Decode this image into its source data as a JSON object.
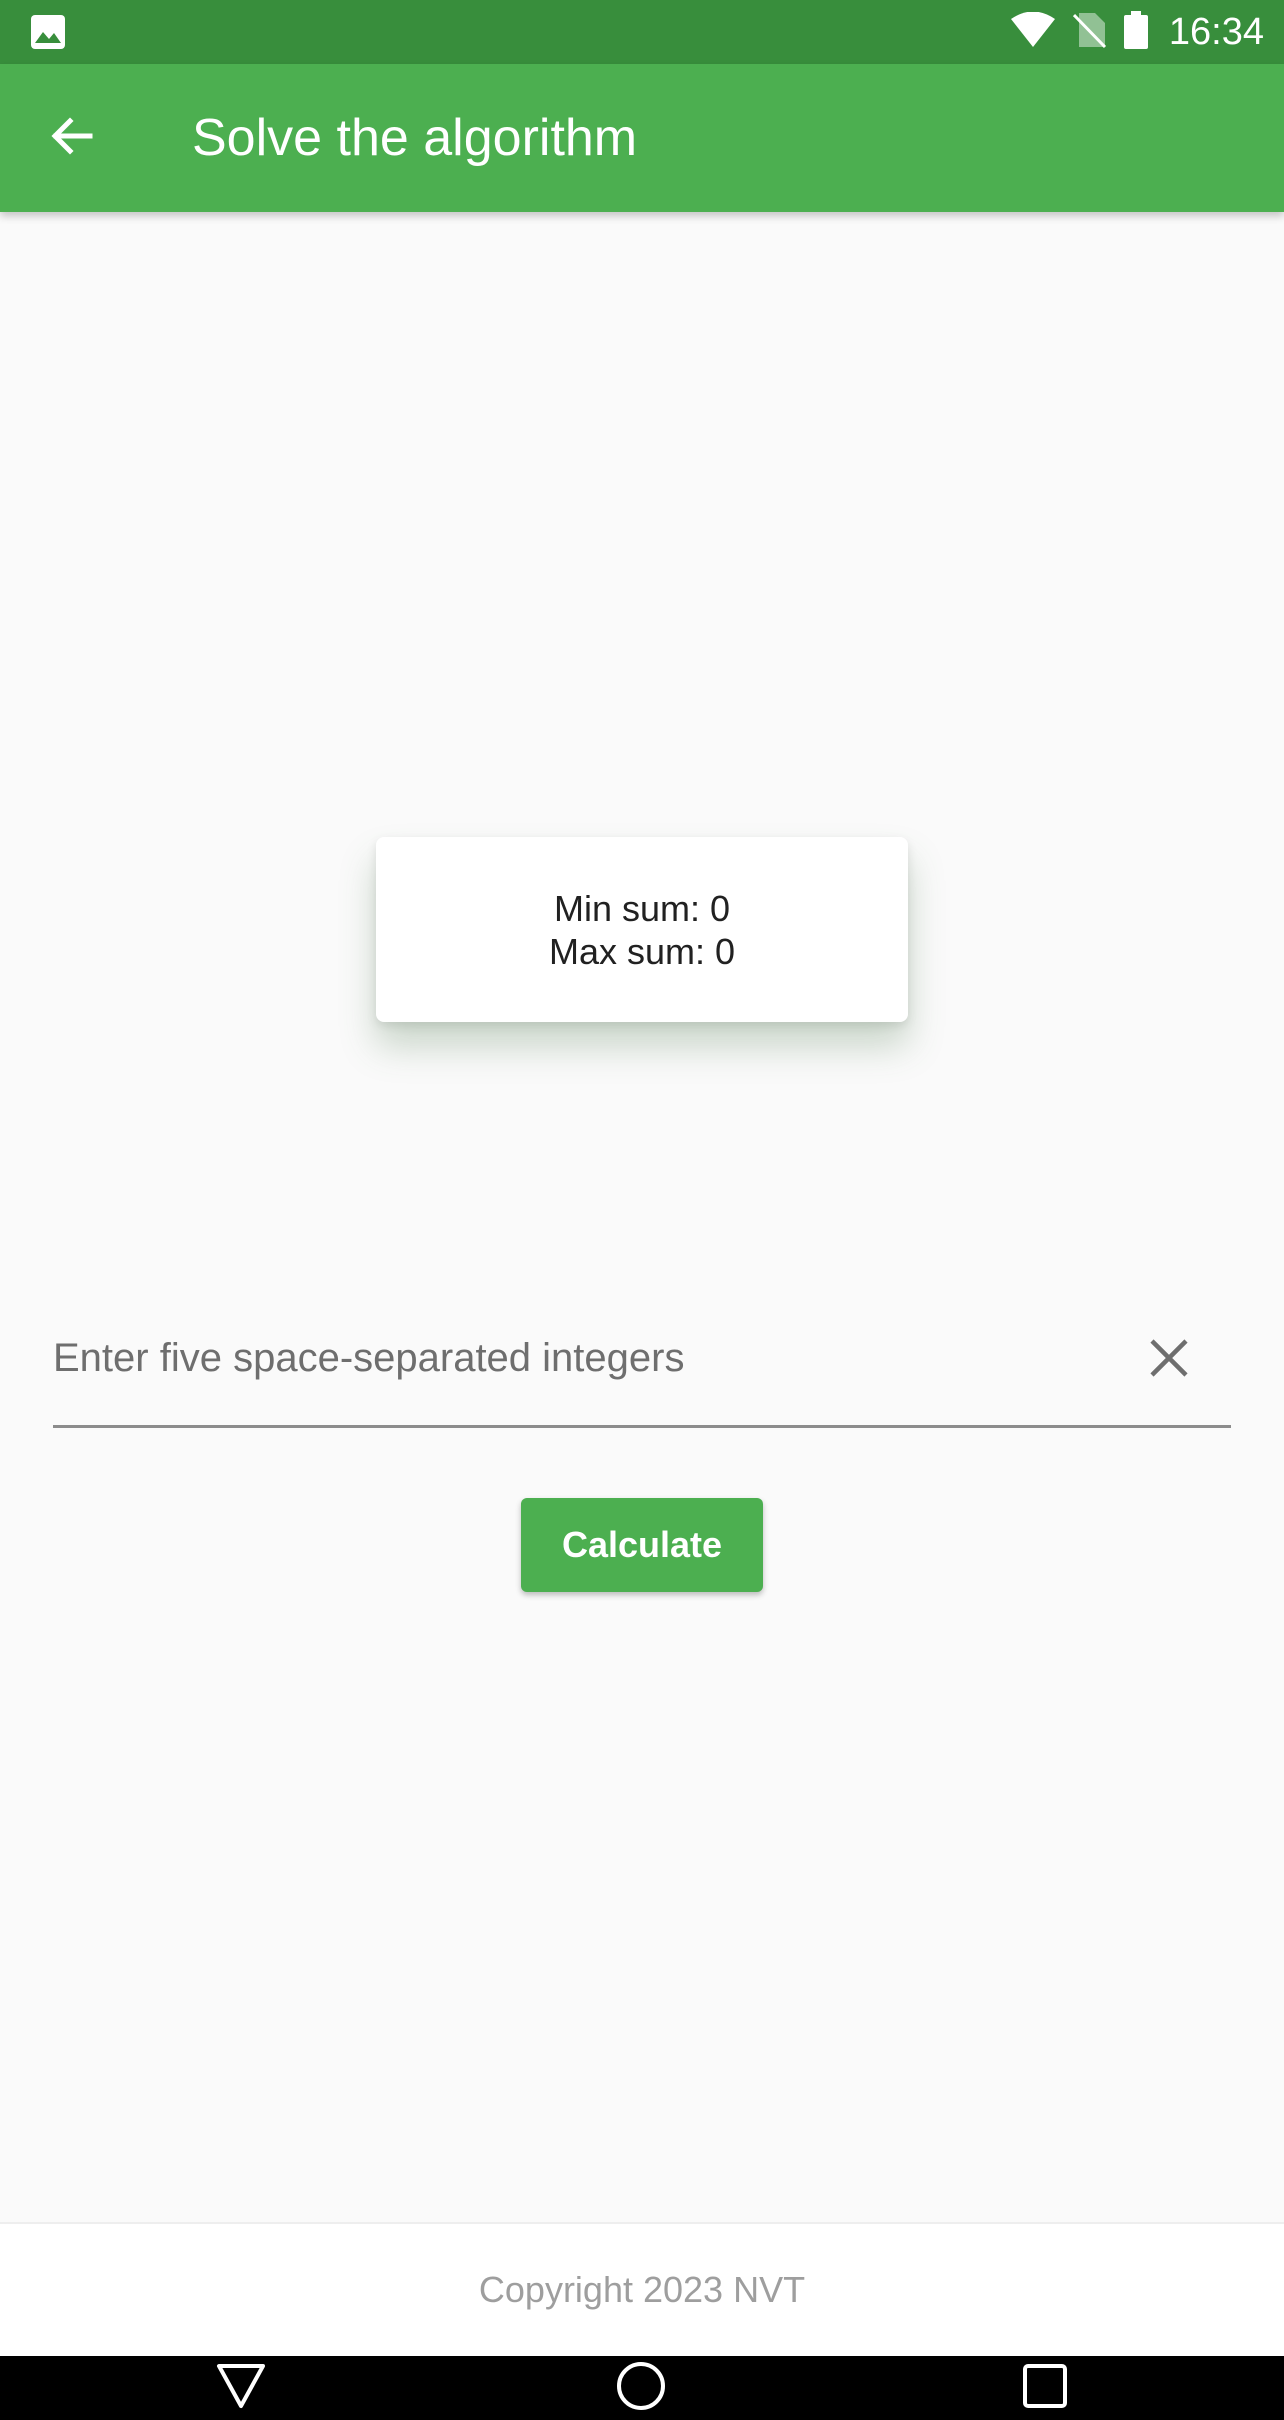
{
  "status_bar": {
    "time": "16:34",
    "icons": [
      "gallery-icon",
      "wifi-icon",
      "no-sim-icon",
      "battery-icon"
    ]
  },
  "app_bar": {
    "title": "Solve the algorithm",
    "back_icon": "arrow-back-icon"
  },
  "result": {
    "min_text": "Min sum: 0",
    "max_text": "Max sum: 0"
  },
  "input": {
    "value": "",
    "placeholder": "Enter five space-separated integers",
    "clear_icon": "close-icon"
  },
  "actions": {
    "calculate_label": "Calculate"
  },
  "footer": {
    "text": "Copyright 2023 NVT"
  },
  "nav_bar": {
    "icons": [
      "back-triangle-icon",
      "home-circle-icon",
      "recents-square-icon"
    ]
  },
  "colors": {
    "status_bar": "#388e3c",
    "primary": "#4caf50",
    "background": "#fafafa"
  }
}
